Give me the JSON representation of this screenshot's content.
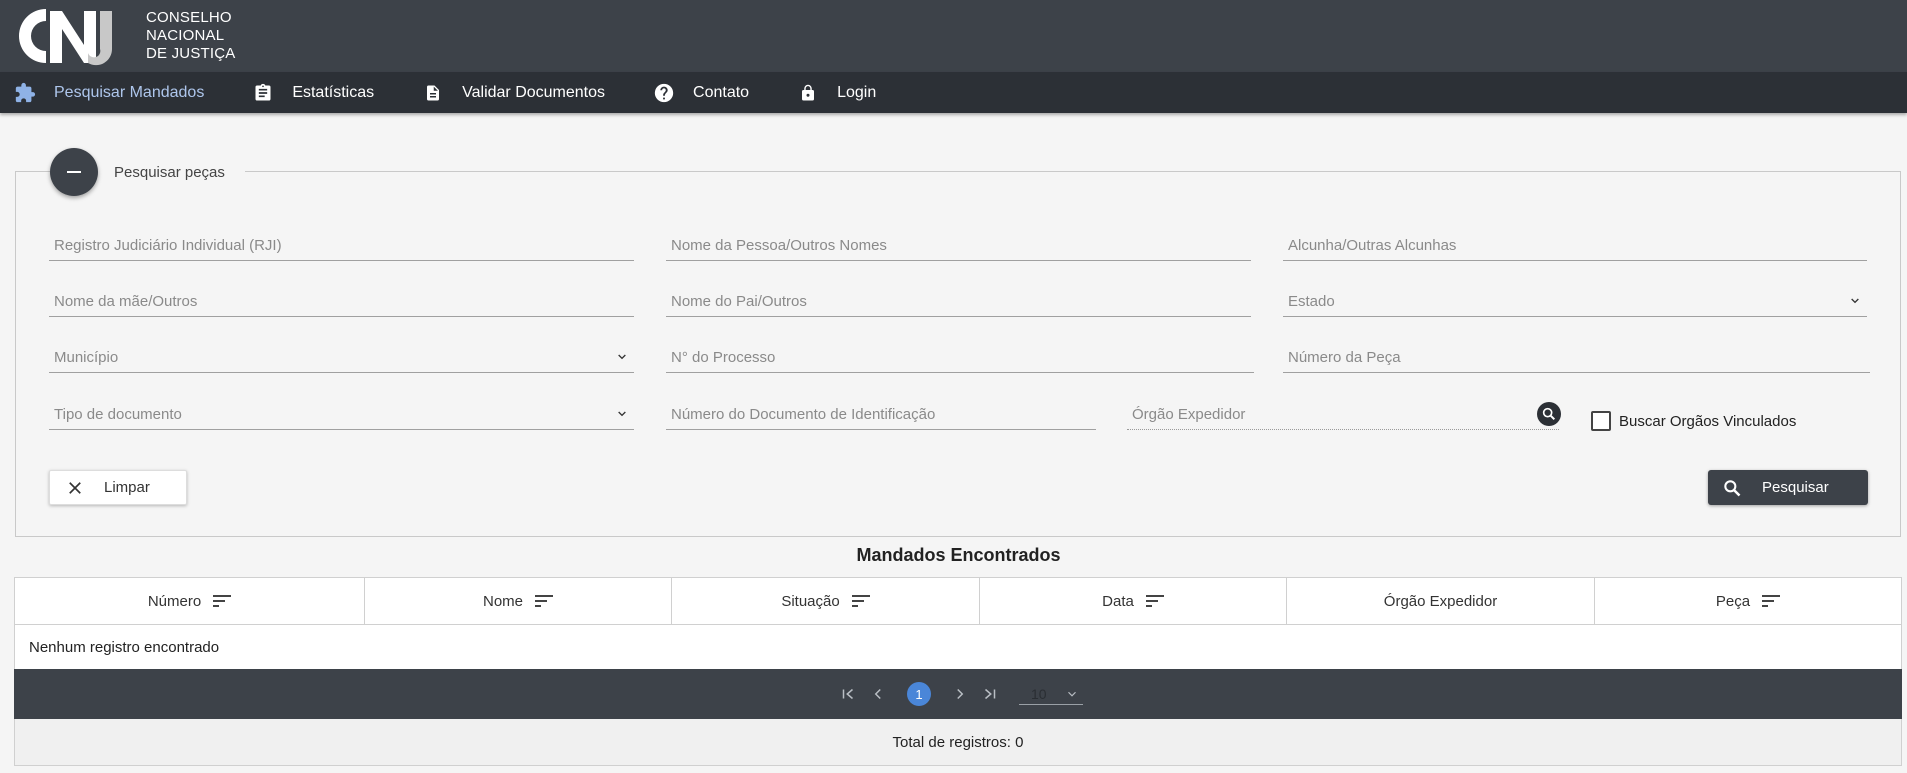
{
  "brand": {
    "line1": "CONSELHO",
    "line2": "NACIONAL",
    "line3": "DE JUSTIÇA"
  },
  "nav": {
    "items": [
      {
        "label": "Pesquisar Mandados",
        "icon": "puzzle-icon",
        "active": true
      },
      {
        "label": "Estatísticas",
        "icon": "clipboard-icon",
        "active": false
      },
      {
        "label": "Validar Documentos",
        "icon": "document-icon",
        "active": false
      },
      {
        "label": "Contato",
        "icon": "help-icon",
        "active": false
      },
      {
        "label": "Login",
        "icon": "lock-icon",
        "active": false
      }
    ]
  },
  "search": {
    "legend": "Pesquisar peças",
    "fields": {
      "rji": "Registro Judiciário Individual (RJI)",
      "nome_pessoa": "Nome da Pessoa/Outros Nomes",
      "alcunha": "Alcunha/Outras Alcunhas",
      "nome_mae": "Nome da mãe/Outros",
      "nome_pai": "Nome do Pai/Outros",
      "estado": "Estado",
      "municipio": "Município",
      "processo": "N° do Processo",
      "numero_peca": "Número da Peça",
      "tipo_documento": "Tipo de documento",
      "numero_documento": "Número do Documento de Identificação",
      "orgao_expedidor": "Órgão Expedidor"
    },
    "checkbox_label": "Buscar Orgãos Vinculados",
    "clear_label": "Limpar",
    "submit_label": "Pesquisar"
  },
  "results": {
    "title": "Mandados Encontrados",
    "columns": [
      {
        "label": "Número",
        "sortable": true
      },
      {
        "label": "Nome",
        "sortable": true
      },
      {
        "label": "Situação",
        "sortable": true
      },
      {
        "label": "Data",
        "sortable": true
      },
      {
        "label": "Órgão Expedidor",
        "sortable": false
      },
      {
        "label": "Peça",
        "sortable": true
      }
    ],
    "empty_message": "Nenhum registro encontrado",
    "pagination": {
      "current_page": "1",
      "rows_per_page": "10"
    },
    "total": "Total de registros: 0"
  },
  "colors": {
    "header_bg": "#3d4249",
    "nav_bg": "#2c3036",
    "active_nav": "#aec6ec",
    "page_badge": "#4a86d8"
  }
}
